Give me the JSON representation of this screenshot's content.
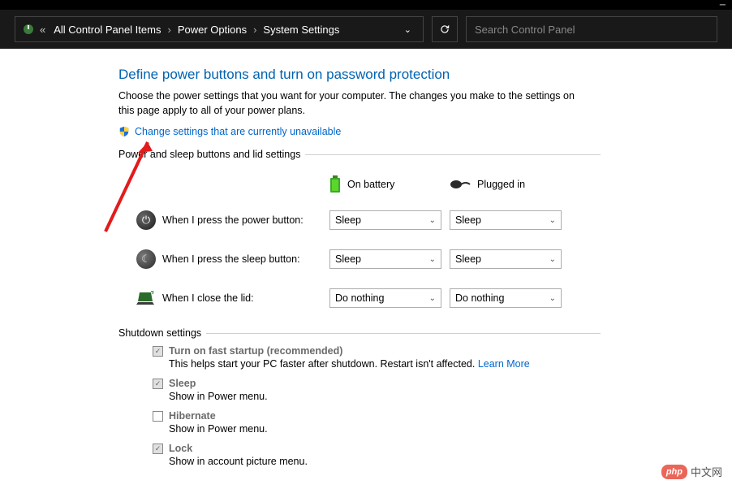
{
  "breadcrumb": {
    "prefix": "«",
    "items": [
      "All Control Panel Items",
      "Power Options",
      "System Settings"
    ]
  },
  "search": {
    "placeholder": "Search Control Panel"
  },
  "page_title": "Define power buttons and turn on password protection",
  "description": "Choose the power settings that you want for your computer. The changes you make to the settings on this page apply to all of your power plans.",
  "change_link": "Change settings that are currently unavailable",
  "section1_title": "Power and sleep buttons and lid settings",
  "columns": {
    "battery": "On battery",
    "plugged": "Plugged in"
  },
  "rows": {
    "power": {
      "label": "When I press the power button:",
      "battery": "Sleep",
      "plugged": "Sleep"
    },
    "sleep": {
      "label": "When I press the sleep button:",
      "battery": "Sleep",
      "plugged": "Sleep"
    },
    "lid": {
      "label": "When I close the lid:",
      "battery": "Do nothing",
      "plugged": "Do nothing"
    }
  },
  "section2_title": "Shutdown settings",
  "shutdown": {
    "fast_startup": {
      "label": "Turn on fast startup (recommended)",
      "desc": "This helps start your PC faster after shutdown. Restart isn't affected. ",
      "learn_more": "Learn More",
      "checked": true
    },
    "sleep": {
      "label": "Sleep",
      "desc": "Show in Power menu.",
      "checked": true
    },
    "hibernate": {
      "label": "Hibernate",
      "desc": "Show in Power menu.",
      "checked": false
    },
    "lock": {
      "label": "Lock",
      "desc": "Show in account picture menu.",
      "checked": true
    }
  },
  "watermark": {
    "badge": "php",
    "text": "中文网"
  }
}
